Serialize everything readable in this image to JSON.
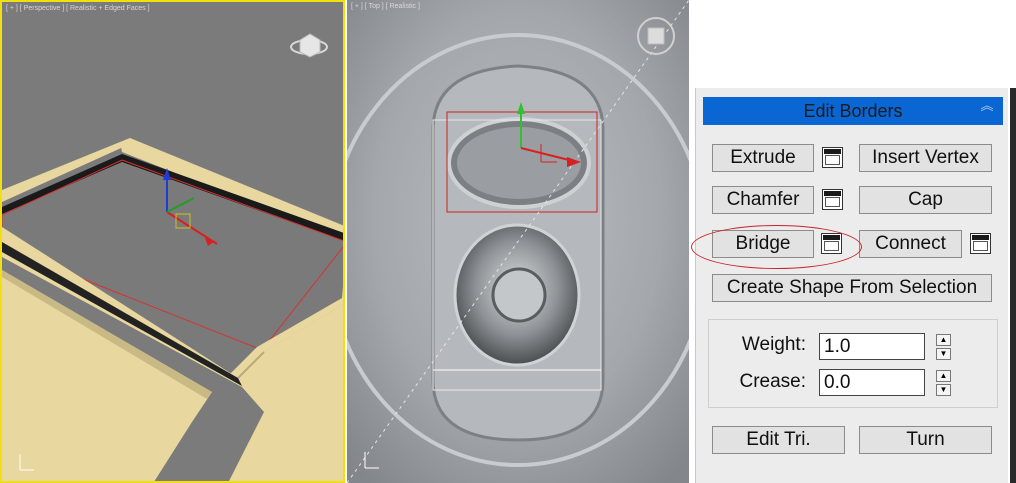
{
  "viewports": {
    "perspective_label": "[ + ] [ Perspective ] [ Realistic + Edged Faces ]",
    "top_label": "[ + ] [ Top ] [ Realistic ]"
  },
  "panel": {
    "title": "Edit Borders",
    "buttons": {
      "extrude": "Extrude",
      "insert_vertex": "Insert Vertex",
      "chamfer": "Chamfer",
      "cap": "Cap",
      "bridge": "Bridge",
      "connect": "Connect",
      "create_shape": "Create Shape From Selection",
      "edit_tri": "Edit Tri.",
      "turn": "Turn"
    },
    "weight": {
      "label": "Weight:",
      "value": "1.0"
    },
    "crease": {
      "label": "Crease:",
      "value": "0.0"
    }
  },
  "colors": {
    "header_blue": "#0a66d2",
    "viewport_active_border": "#f0e010",
    "annotation_red": "#c8242b"
  }
}
